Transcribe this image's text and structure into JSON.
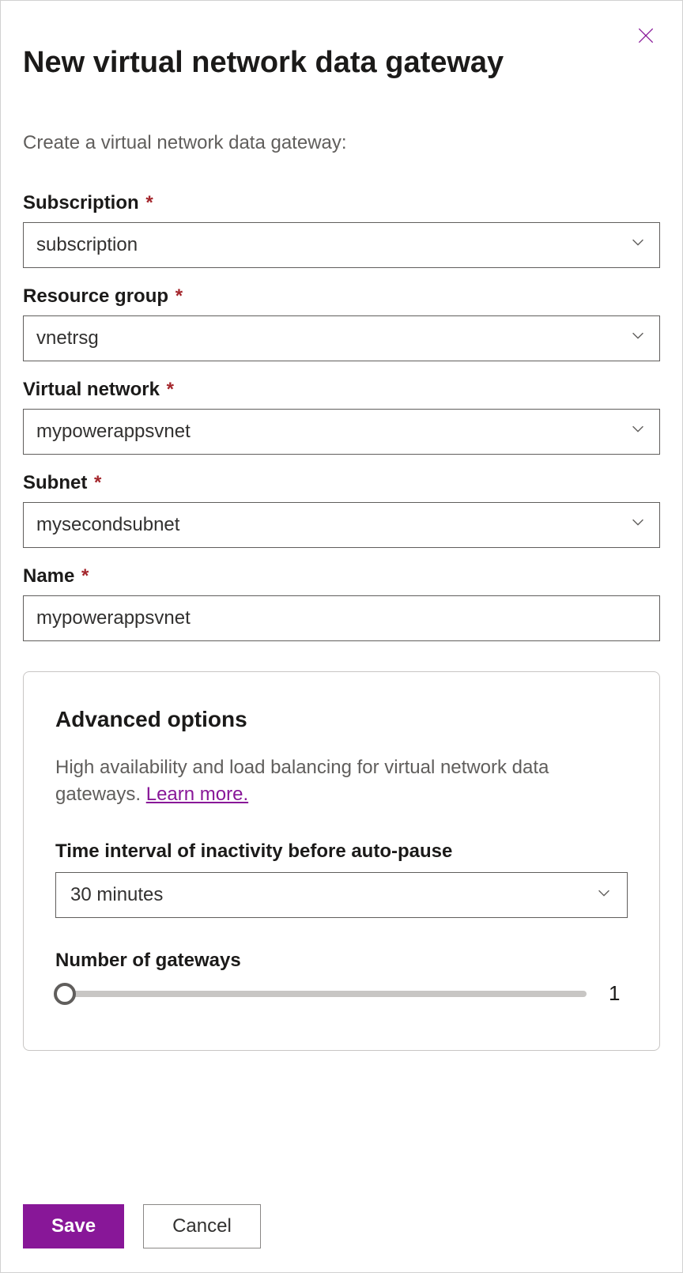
{
  "header": {
    "title": "New virtual network data gateway",
    "subtitle": "Create a virtual network data gateway:"
  },
  "fields": {
    "subscription": {
      "label": "Subscription",
      "value": "subscription",
      "required": true
    },
    "resource_group": {
      "label": "Resource group",
      "value": "vnetrsg",
      "required": true
    },
    "virtual_network": {
      "label": "Virtual network",
      "value": "mypowerappsvnet",
      "required": true
    },
    "subnet": {
      "label": "Subnet",
      "value": "mysecondsubnet",
      "required": true
    },
    "name": {
      "label": "Name",
      "value": "mypowerappsvnet",
      "required": true
    }
  },
  "advanced": {
    "heading": "Advanced options",
    "description": "High availability and load balancing for virtual network data gateways. ",
    "learn_more": "Learn more.",
    "time_interval": {
      "label": "Time interval of inactivity before auto-pause",
      "value": "30 minutes"
    },
    "num_gateways": {
      "label": "Number of gateways",
      "value": "1"
    }
  },
  "footer": {
    "save": "Save",
    "cancel": "Cancel"
  },
  "required_mark": "*"
}
